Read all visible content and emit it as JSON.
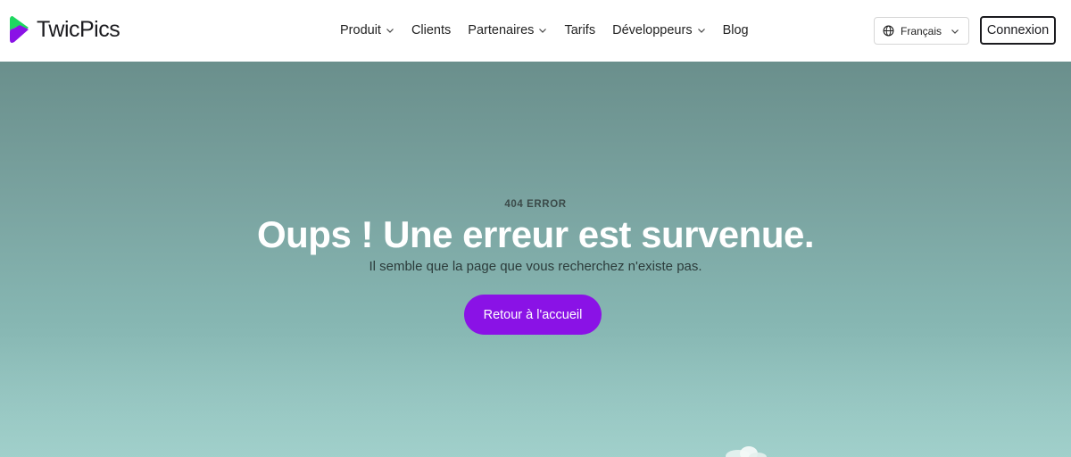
{
  "brand": {
    "name": "TwicPics",
    "colors": {
      "accent": "#8a12e6",
      "logo_green": "#1ed760",
      "logo_purple": "#8a12e6"
    }
  },
  "nav": {
    "items": [
      {
        "label": "Produit",
        "has_dropdown": true
      },
      {
        "label": "Clients",
        "has_dropdown": false
      },
      {
        "label": "Partenaires",
        "has_dropdown": true
      },
      {
        "label": "Tarifs",
        "has_dropdown": false
      },
      {
        "label": "Développeurs",
        "has_dropdown": true
      },
      {
        "label": "Blog",
        "has_dropdown": false
      }
    ]
  },
  "language": {
    "selected": "Français",
    "icon": "globe-icon"
  },
  "login": {
    "label": "Connexion"
  },
  "error_page": {
    "eyebrow": "404 ERROR",
    "title": "Oups ! Une erreur est survenue.",
    "subtitle": "Il semble que la page que vous recherchez n'existe pas.",
    "cta_label": "Retour à l'accueil"
  }
}
